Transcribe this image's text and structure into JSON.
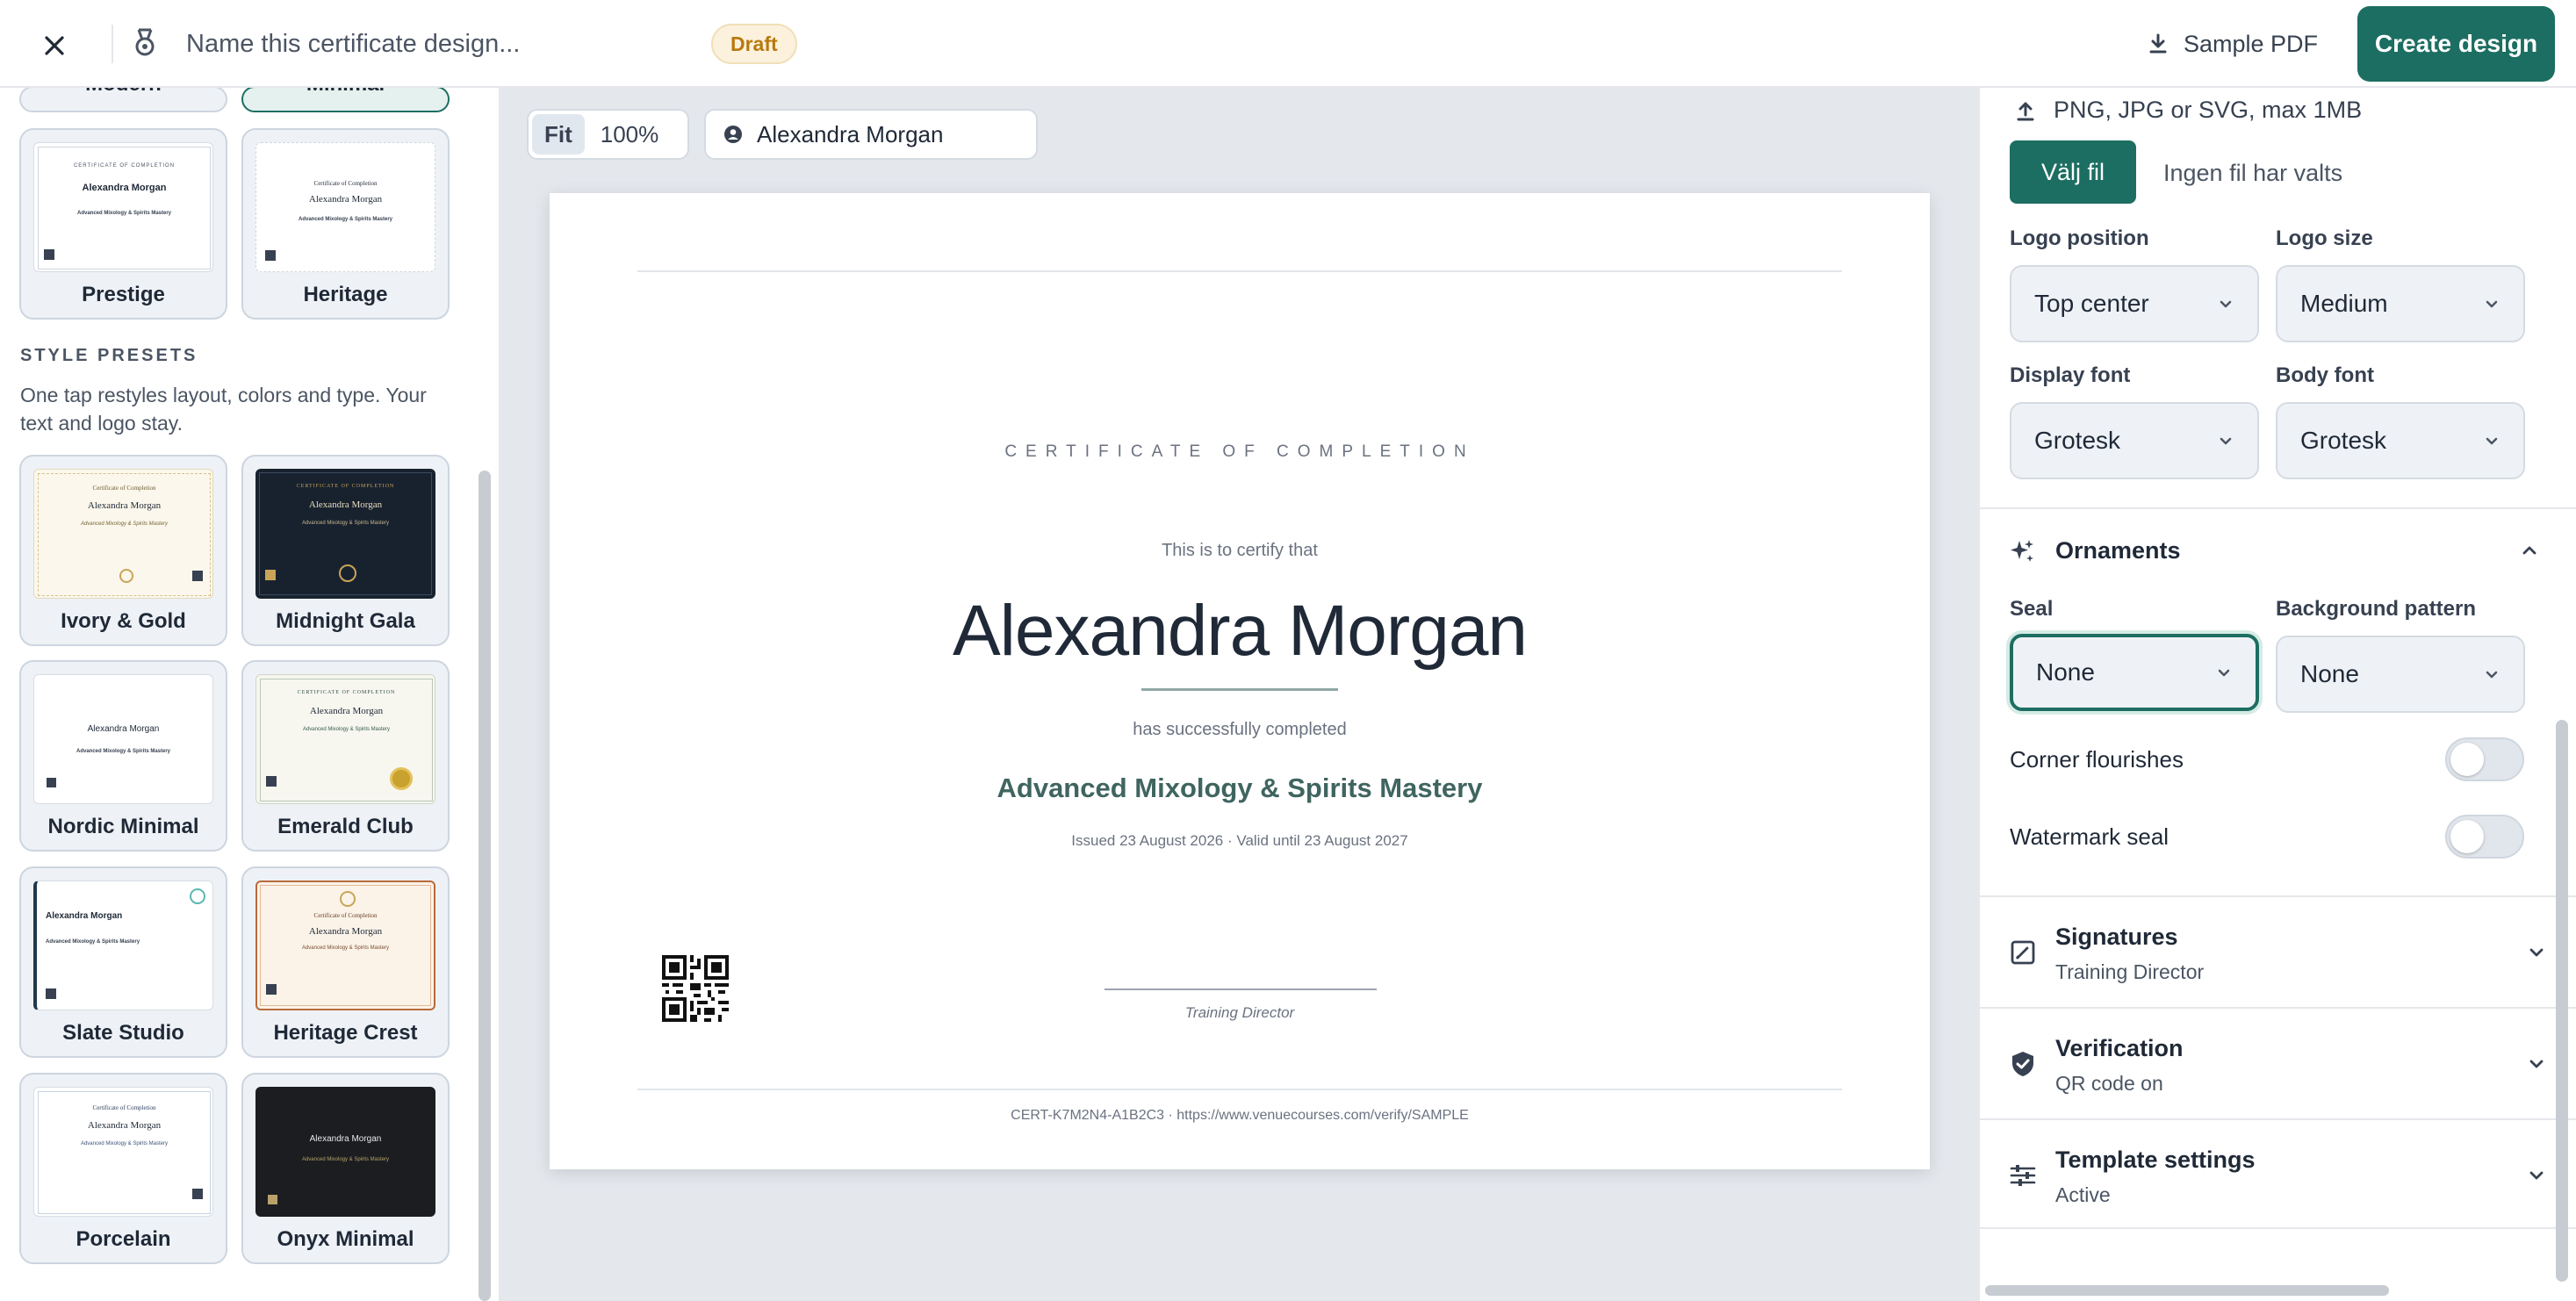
{
  "header": {
    "title_placeholder": "Name this certificate design...",
    "status_badge": "Draft",
    "sample_pdf_label": "Sample PDF",
    "create_label": "Create design"
  },
  "templates": {
    "partial_left": "Modern",
    "partial_right": "Minimal",
    "items": [
      {
        "name": "Prestige"
      },
      {
        "name": "Heritage"
      }
    ]
  },
  "style_presets": {
    "heading": "STYLE PRESETS",
    "description": "One tap restyles layout, colors and type. Your text and logo stay.",
    "items": [
      {
        "name": "Ivory & Gold"
      },
      {
        "name": "Midnight Gala"
      },
      {
        "name": "Nordic Minimal"
      },
      {
        "name": "Emerald Club"
      },
      {
        "name": "Slate Studio"
      },
      {
        "name": "Heritage Crest"
      },
      {
        "name": "Porcelain"
      },
      {
        "name": "Onyx Minimal"
      }
    ]
  },
  "thumb_text": {
    "kicker": "CERTIFICATE OF COMPLETION",
    "kicker_serif": "Certificate of Completion",
    "name": "Alexandra Morgan",
    "course": "Advanced Mixology & Spirits Mastery"
  },
  "canvas": {
    "zoom_fit": "Fit",
    "zoom_100": "100%",
    "recipient": "Alexandra Morgan"
  },
  "certificate": {
    "kicker": "CERTIFICATE OF COMPLETION",
    "certify": "This is to certify that",
    "name": "Alexandra Morgan",
    "completed": "has successfully completed",
    "course": "Advanced Mixology & Spirits Mastery",
    "issued": "Issued 23 August 2026 · Valid until 23 August 2027",
    "signature_title": "Training Director",
    "footer": "CERT-K7M2N4-A1B2C3 · https://www.venuecourses.com/verify/SAMPLE"
  },
  "settings": {
    "logo_hint": "PNG, JPG or SVG, max 1MB",
    "choose_file": "Välj fil",
    "no_file": "Ingen fil har valts",
    "logo_position_label": "Logo position",
    "logo_position": "Top center",
    "logo_size_label": "Logo size",
    "logo_size": "Medium",
    "display_font_label": "Display font",
    "display_font": "Grotesk",
    "body_font_label": "Body font",
    "body_font": "Grotesk",
    "ornaments": {
      "title": "Ornaments",
      "seal_label": "Seal",
      "seal": "None",
      "bg_label": "Background pattern",
      "bg": "None",
      "corner_label": "Corner flourishes",
      "corner_on": false,
      "watermark_label": "Watermark seal",
      "watermark_on": false
    },
    "sections": [
      {
        "title": "Signatures",
        "subtitle": "Training Director"
      },
      {
        "title": "Verification",
        "subtitle": "QR code on"
      },
      {
        "title": "Template settings",
        "subtitle": "Active"
      }
    ]
  },
  "colors": {
    "accent": "#1d6e62",
    "course_text": "#3f6560",
    "draft_badge": "#b9790f"
  }
}
